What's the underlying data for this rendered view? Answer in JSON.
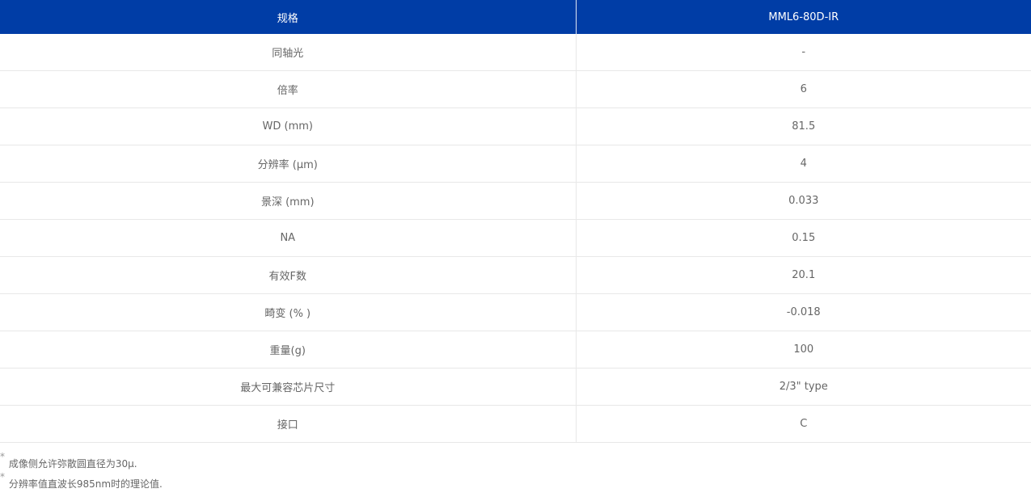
{
  "table": {
    "header": {
      "spec_label": "规格",
      "model": "MML6-80D-IR"
    },
    "rows": [
      {
        "label": "同轴光",
        "value": "-"
      },
      {
        "label": "倍率",
        "value": "6"
      },
      {
        "label": "WD (mm)",
        "value": "81.5"
      },
      {
        "label": "分辨率 (μm)",
        "value": "4"
      },
      {
        "label": "景深 (mm)",
        "value": "0.033"
      },
      {
        "label": "NA",
        "value": "0.15"
      },
      {
        "label": "有效F数",
        "value": "20.1"
      },
      {
        "label": "畸变 (% )",
        "value": "-0.018"
      },
      {
        "label": "重量(g)",
        "value": "100"
      },
      {
        "label": "最大可兼容芯片尺寸",
        "value": "2/3\" type"
      },
      {
        "label": "接口",
        "value": "C"
      }
    ]
  },
  "footnotes": [
    {
      "mark": "*",
      "text": "成像侧允许弥散圆直径为30μ."
    },
    {
      "mark": "*",
      "text": "分辨率值直波长985nm时的理论值."
    }
  ],
  "colors": {
    "header_bg": "#003da6",
    "header_text": "#ffffff",
    "body_text": "#666666",
    "row_border": "#e8e8e8"
  }
}
